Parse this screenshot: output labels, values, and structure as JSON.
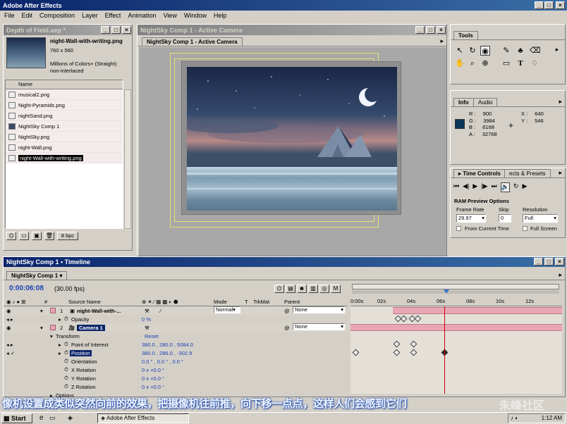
{
  "app": {
    "title": "Adobe After Effects"
  },
  "menu": [
    "File",
    "Edit",
    "Composition",
    "Layer",
    "Effect",
    "Animation",
    "View",
    "Window",
    "Help"
  ],
  "project": {
    "title": "Depth of Field.aep *",
    "selected_name": "night-Wall-with-writing.png",
    "dims": "760 x 560",
    "colors": "Millions of Colors+ (Straight)",
    "interlace": "non-interlaced",
    "col_name": "Name",
    "items": [
      "musical2.png",
      "Night-Pyramids.png",
      "nightSand.png",
      "NightSky Comp 1",
      "NightSky.png",
      "night-Wall.png",
      "night-Wall-with-writing.png"
    ],
    "bpc": "8 bpc"
  },
  "comp": {
    "window_title": "NightSky Comp 1 - Active Camera",
    "tab": "NightSky Comp 1 - Active Camera"
  },
  "tools": {
    "title": "Tools"
  },
  "info": {
    "tab_info": "Info",
    "tab_audio": "Audio",
    "r_label": "R :",
    "r": "900",
    "g_label": "G :",
    "g": "3984",
    "b_label": "B :",
    "b": "6168",
    "a_label": "A :",
    "a": "32768",
    "x_label": "X :",
    "x": "640",
    "y_label": "Y :",
    "y": "546"
  },
  "time_controls": {
    "tab": "Time Controls",
    "tab2": "ects & Presets",
    "ram_title": "RAM Preview Options",
    "frame_rate_label": "Frame Rate",
    "skip_label": "Skip",
    "resolution_label": "Resolution",
    "frame_rate": "29.97",
    "skip": "0",
    "resolution": "Full",
    "from_current": "From Current Time",
    "full_screen": "Full Screen"
  },
  "timeline": {
    "window_title": "NightSky Comp 1 • Timeline",
    "tab": "NightSky Comp 1",
    "timecode": "0:00:06:08",
    "fps": "(30.00 fps)",
    "col_source": "Source Name",
    "col_mode": "Mode",
    "col_t": "T",
    "col_trkmat": "TrkMat",
    "col_parent": "Parent",
    "ruler": [
      "0:00s",
      "02s",
      "04s",
      "06s",
      "08s",
      "10s",
      "12s"
    ],
    "layer1_num": "1",
    "layer1_name": "night-Wall-with-...",
    "layer1_mode": "Normal",
    "layer1_parent": "None",
    "opacity_label": "Opacity",
    "opacity_value": "0 %",
    "layer2_num": "2",
    "layer2_name": "Camera 1",
    "layer2_parent": "None",
    "transform_label": "Transform",
    "reset_label": "Reset",
    "poi_label": "Point of Interest",
    "poi_value": "380.0 , 280.0 , 5084.0",
    "position_label": "Position",
    "position_value": "380.0 , 286.0 , -302.9",
    "orientation_label": "Orientation",
    "orientation_value": "0.0 ° , 0.0 ° , 0.0 °",
    "xrot_label": "X Rotation",
    "xrot_value": "0 x +0.0 °",
    "yrot_label": "Y Rotation",
    "yrot_value": "0 x +0.0 °",
    "zrot_label": "Z Rotation",
    "zrot_value": "0 x +0.0 °",
    "options_label": "Options"
  },
  "caption": "像机设置成类似突然向前的效果，把摄像机往前推，向下移一点点，这样人们会感到它们",
  "watermark": "朱峰社区",
  "taskbar": {
    "start": "Start",
    "task": "Adobe After Effects",
    "clock": "1:12 AM"
  },
  "colors": {
    "titlebar": "#0a246a",
    "layer_bar": "#e8a6b4",
    "playhead": "#d00000",
    "caption_text": "#f2f6ff"
  }
}
